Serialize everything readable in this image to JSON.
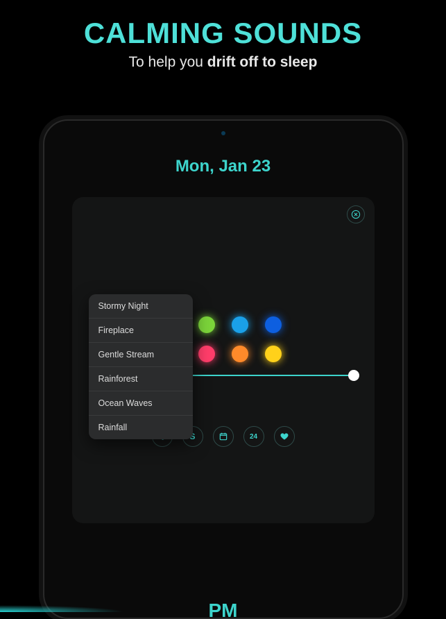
{
  "promo": {
    "title": "CALMING SOUNDS",
    "sub_a": "To help you ",
    "sub_b": "drift off to sleep"
  },
  "screen": {
    "date": "Mon, Jan 23",
    "pm": "PM"
  },
  "menu": {
    "items": [
      {
        "label": "Stormy Night"
      },
      {
        "label": "Fireplace"
      },
      {
        "label": "Gentle Stream"
      },
      {
        "label": "Rainforest"
      },
      {
        "label": "Ocean Waves"
      },
      {
        "label": "Rainfall"
      }
    ]
  },
  "colors": {
    "row1": [
      {
        "hex": "#3dd4cc",
        "selected": true
      },
      {
        "hex": "#7bd43a"
      },
      {
        "hex": "#1aa0e8"
      },
      {
        "hex": "#0d5fe0"
      }
    ],
    "row2": [
      {
        "hex": "#b03de0"
      },
      {
        "hex": "#ff3d6a"
      },
      {
        "hex": "#ff8a2a"
      },
      {
        "hex": "#ffd11a"
      }
    ]
  },
  "tools": [
    {
      "name": "thermometer-icon"
    },
    {
      "name": "letter-s"
    },
    {
      "name": "calendar-icon"
    },
    {
      "name": "twentyfour"
    },
    {
      "name": "heart-icon"
    }
  ]
}
